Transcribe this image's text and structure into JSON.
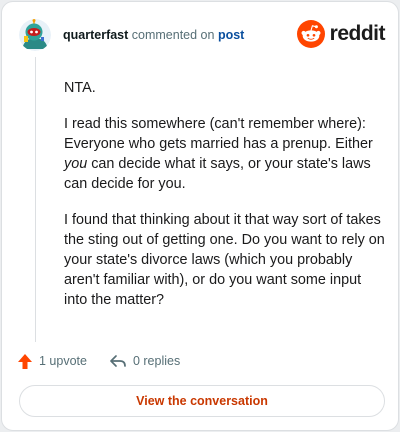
{
  "header": {
    "username": "quarterfast",
    "action_text": "commented on",
    "post_link": "post",
    "brand_name": "reddit"
  },
  "comment": {
    "paragraphs": [
      {
        "text": "NTA."
      },
      {
        "text": "I read this somewhere (can't remember where): Everyone who gets married has a prenup. Either",
        "emphasis": "you",
        "text_after": "can decide what it says, or your state's laws can decide for you."
      },
      {
        "text": "I found that thinking about it that way sort of takes the sting out of getting one. Do you want to rely on your state's divorce laws (which you probably aren't familiar with), or do you want some input into the matter?"
      }
    ]
  },
  "actions": {
    "upvote_label": "1 upvote",
    "replies_label": "0 replies"
  },
  "cta": {
    "label": "View the conversation"
  },
  "colors": {
    "brand_orange": "#ff4500",
    "upvote_orange": "#ff4500",
    "link_blue": "#0a4f9e",
    "cta_text": "#c93800"
  },
  "icons": {
    "avatar": "snoo-avatar",
    "brand": "reddit-logo-icon",
    "upvote": "upvote-arrow-icon",
    "reply": "reply-arrow-icon"
  }
}
